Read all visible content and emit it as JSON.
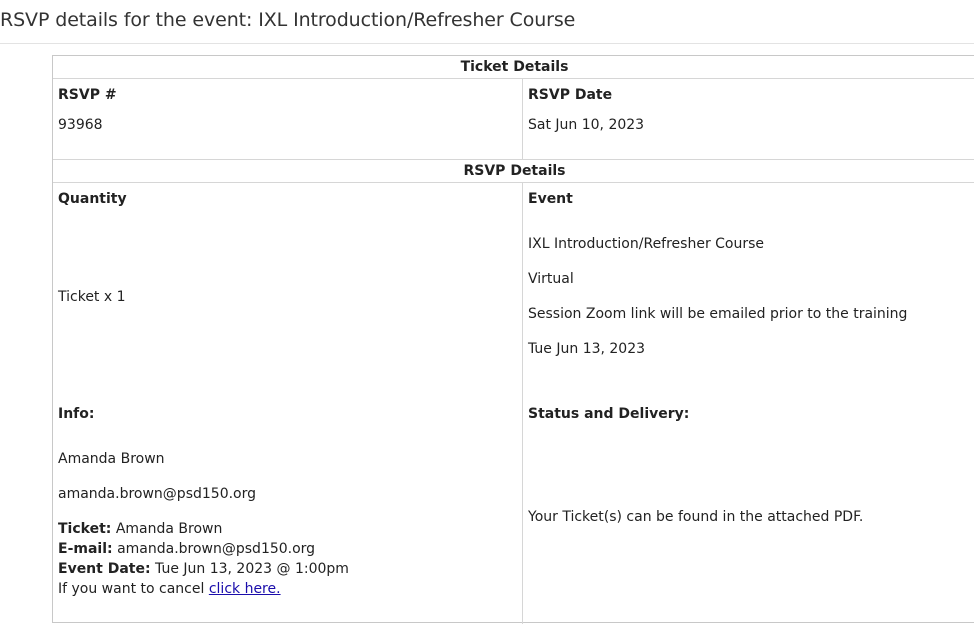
{
  "page": {
    "title": "RSVP details for the event: IXL Introduction/Refresher Course"
  },
  "ticket_details": {
    "header": "Ticket Details",
    "rsvp_number_label": "RSVP #",
    "rsvp_number_value": "93968",
    "rsvp_date_label": "RSVP Date",
    "rsvp_date_value": "Sat Jun 10, 2023"
  },
  "rsvp_details": {
    "header": "RSVP Details",
    "quantity_label": "Quantity",
    "quantity_value": "Ticket x 1",
    "event_label": "Event",
    "event_name": "IXL Introduction/Refresher Course",
    "event_location": "Virtual",
    "event_note": "Session Zoom link will be emailed prior to the training",
    "event_date": "Tue Jun 13, 2023",
    "info_label": "Info:",
    "info_name": "Amanda Brown",
    "info_email": "amanda.brown@psd150.org",
    "ticket_label": "Ticket:",
    "ticket_value": "Amanda Brown",
    "email_label": "E-mail:",
    "email_value": "amanda.brown@psd150.org",
    "event_date_label": "Event Date:",
    "event_date_value": "Tue Jun 13, 2023 @ 1:00pm",
    "cancel_text": "If you want to cancel",
    "cancel_link": "click here.",
    "status_label": "Status and Delivery:",
    "status_value": "Your Ticket(s) can be found in the attached PDF."
  }
}
